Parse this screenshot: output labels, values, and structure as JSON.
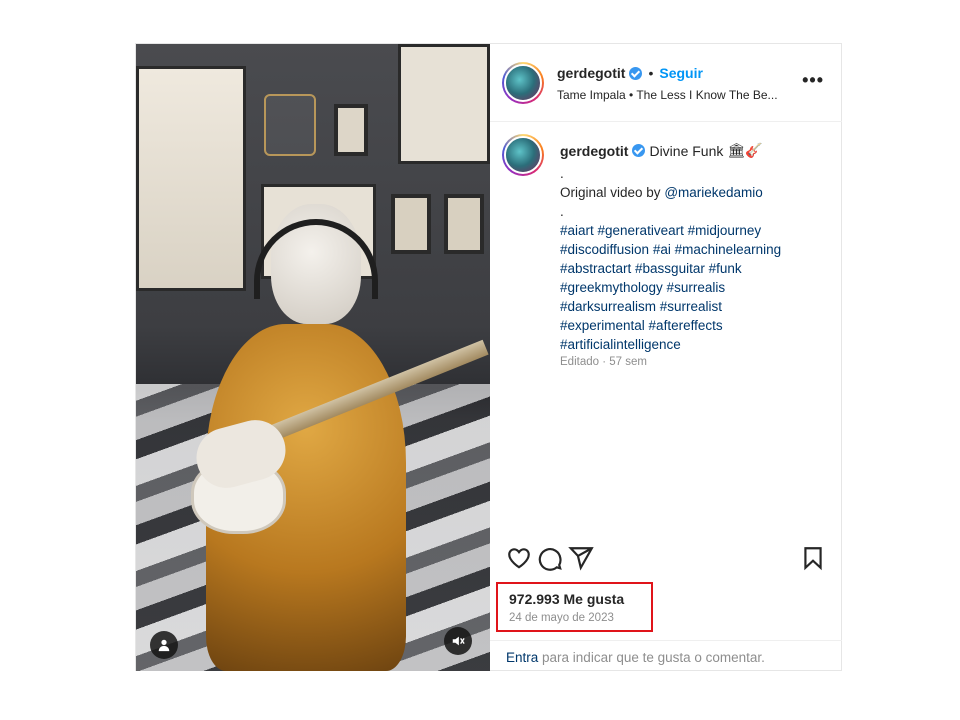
{
  "post": {
    "username": "gerdegotit",
    "follow_label": "Seguir",
    "separator": "•",
    "audio": "Tame Impala • The Less I Know The Be...",
    "more_label": "•••"
  },
  "caption": {
    "username": "gerdegotit",
    "title": "Divine Funk",
    "emoji": "🏛🎸",
    "dot1": ".",
    "credit_prefix": "Original video by ",
    "credit_mention": "@mariekedamio",
    "dot2": ".",
    "hashtags": [
      "#aiart #generativeart #midjourney",
      "#discodiffusion #ai #machinelearning",
      "#abstractart #bassguitar #funk",
      "#greekmythology #surrealis",
      "#darksurrealism #surrealist",
      "#experimental #aftereffects",
      "#artificialintelligence"
    ],
    "meta": "Editado · 57 sem"
  },
  "stats": {
    "likes": "972.993 Me gusta",
    "date": "24 de mayo de 2023"
  },
  "comment": {
    "entra": "Entra",
    "rest": " para indicar que te gusta o comentar."
  },
  "icons": {
    "like": "heart-icon",
    "comment": "comment-icon",
    "share": "share-icon",
    "save": "bookmark-icon",
    "user_tag": "user-icon",
    "mute": "mute-icon"
  },
  "colors": {
    "link": "#0095f6",
    "hashtag": "#00376b",
    "highlight_box": "#e0141a",
    "verified": "#3897f0"
  }
}
